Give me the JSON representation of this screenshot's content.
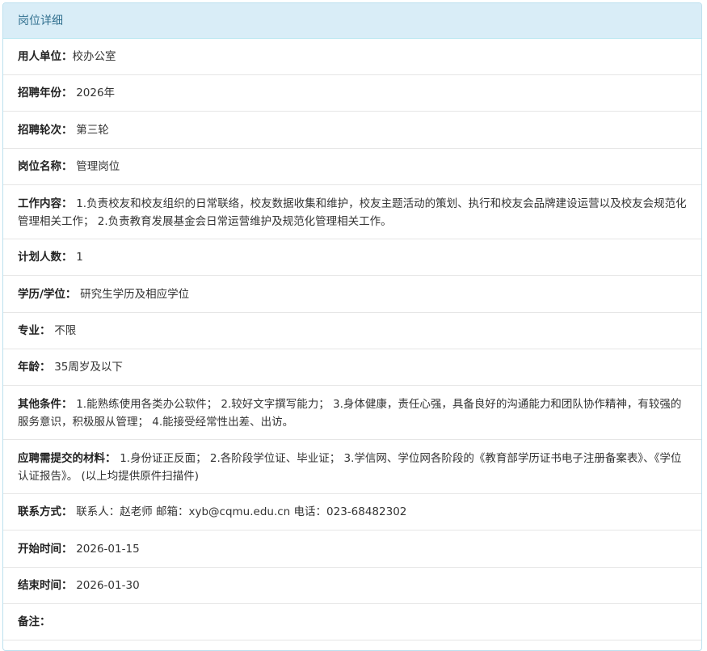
{
  "panel": {
    "title": "岗位详细"
  },
  "fields": [
    {
      "label": "用人单位：",
      "value": "校办公室"
    },
    {
      "label": "招聘年份： ",
      "value": "2026年"
    },
    {
      "label": "招聘轮次： ",
      "value": "第三轮"
    },
    {
      "label": "岗位名称： ",
      "value": "管理岗位"
    },
    {
      "label": "工作内容： ",
      "value": "1.负责校友和校友组织的日常联络，校友数据收集和维护，校友主题活动的策划、执行和校友会品牌建设运营以及校友会规范化管理相关工作； 2.负责教育发展基金会日常运营维护及规范化管理相关工作。"
    },
    {
      "label": "计划人数： ",
      "value": "1"
    },
    {
      "label": "学历/学位： ",
      "value": "研究生学历及相应学位"
    },
    {
      "label": "专业： ",
      "value": "不限"
    },
    {
      "label": "年龄： ",
      "value": "35周岁及以下"
    },
    {
      "label": "其他条件： ",
      "value": "1.能熟练使用各类办公软件； 2.较好文字撰写能力； 3.身体健康，责任心强，具备良好的沟通能力和团队协作精神，有较强的服务意识，积极服从管理； 4.能接受经常性出差、出访。"
    },
    {
      "label": "应聘需提交的材料： ",
      "value": "1.身份证正反面； 2.各阶段学位证、毕业证； 3.学信网、学位网各阶段的《教育部学历证书电子注册备案表》、《学位认证报告》。  (以上均提供原件扫描件)"
    },
    {
      "label": "联系方式： ",
      "value": "联系人：赵老师 邮箱：xyb@cqmu.edu.cn 电话：023-68482302"
    },
    {
      "label": "开始时间： ",
      "value": "2026-01-15"
    },
    {
      "label": "结束时间： ",
      "value": "2026-01-30"
    },
    {
      "label": "备注： ",
      "value": ""
    }
  ]
}
